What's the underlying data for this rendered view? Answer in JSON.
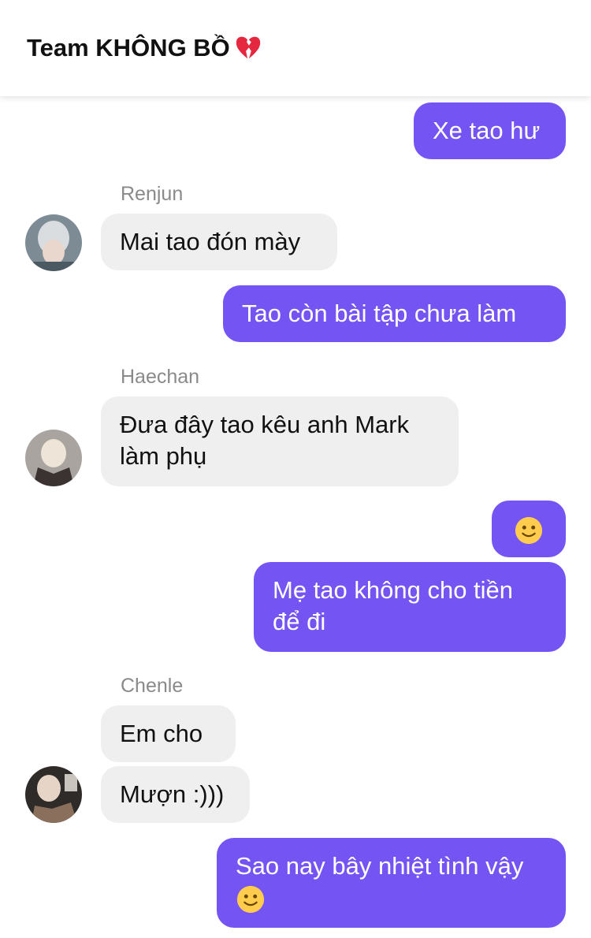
{
  "header": {
    "title": "Team KHÔNG BỒ",
    "title_icon": "broken-heart-icon"
  },
  "messages": [
    {
      "from": "me",
      "text": "Xe tao hư"
    },
    {
      "from": "Renjun",
      "text": "Mai tao đón mày"
    },
    {
      "from": "me",
      "text": "Tao còn bài tập chưa làm"
    },
    {
      "from": "Haechan",
      "line1": "Đưa đây tao kêu anh Mark",
      "line2": "làm phụ"
    },
    {
      "from": "me",
      "emoji": "slightly-smiling-face-icon"
    },
    {
      "from": "me",
      "line1": "Mẹ tao không cho tiền",
      "line2": "để đi"
    },
    {
      "from": "Chenle",
      "text": "Em cho"
    },
    {
      "from": "Chenle",
      "text": "Mượn :)))"
    },
    {
      "from": "me",
      "line1": "Sao nay bây nhiệt tình vậy",
      "emoji": "slightly-smiling-face-icon"
    }
  ],
  "senders": {
    "renjun": "Renjun",
    "haechan": "Haechan",
    "chenle": "Chenle"
  },
  "colors": {
    "outgoing": "#7455f4",
    "incoming": "#efefef",
    "sender_name": "#8a8a8a"
  }
}
